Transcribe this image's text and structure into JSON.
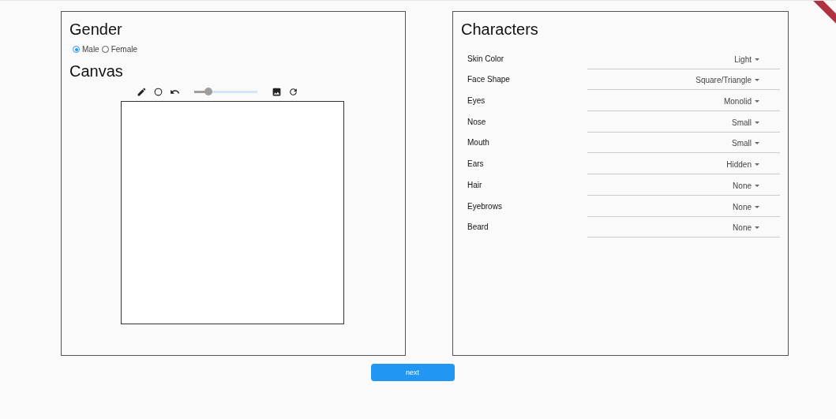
{
  "gender": {
    "title": "Gender",
    "options": [
      {
        "label": "Male",
        "selected": true
      },
      {
        "label": "Female",
        "selected": false
      }
    ]
  },
  "canvas": {
    "title": "Canvas",
    "brush_size": {
      "level": 0.22
    }
  },
  "characters": {
    "title": "Characters",
    "fields": [
      {
        "label": "Skin Color",
        "value": "Light"
      },
      {
        "label": "Face Shape",
        "value": "Square/Triangle"
      },
      {
        "label": "Eyes",
        "value": "Monolid"
      },
      {
        "label": "Nose",
        "value": "Small"
      },
      {
        "label": "Mouth",
        "value": "Small"
      },
      {
        "label": "Ears",
        "value": "Hidden"
      },
      {
        "label": "Hair",
        "value": "None"
      },
      {
        "label": "Eyebrows",
        "value": "None"
      },
      {
        "label": "Beard",
        "value": "None"
      }
    ]
  },
  "next_button": "next"
}
